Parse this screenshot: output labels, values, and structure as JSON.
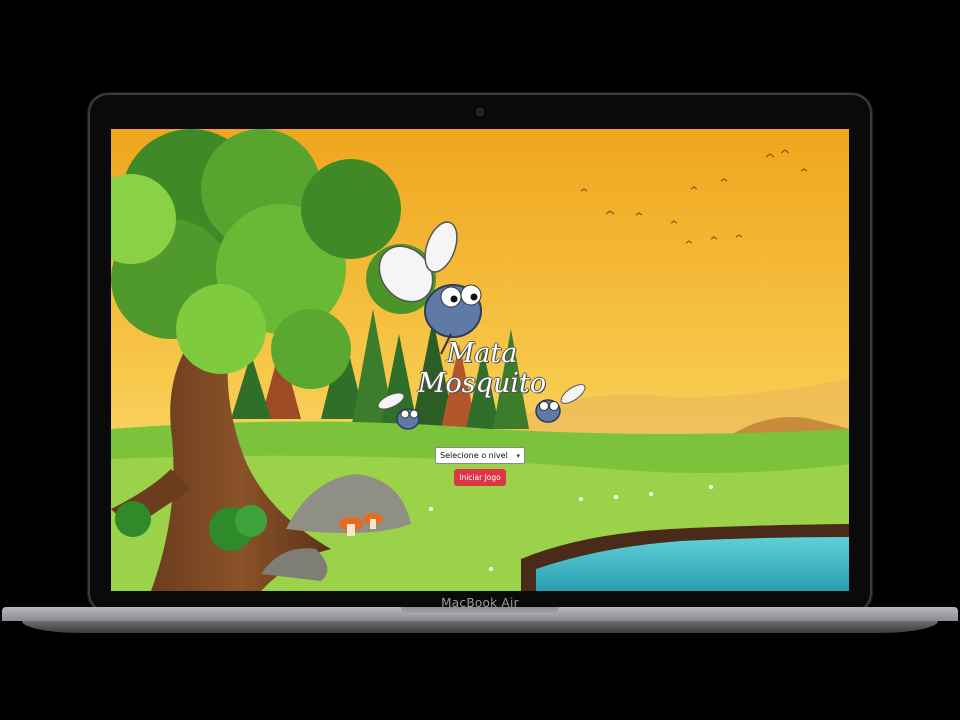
{
  "device": {
    "model_label": "MacBook Air"
  },
  "game": {
    "title_line1": "Mata",
    "title_line2": "Mosquito",
    "level_select": {
      "selected": "Selecione o nivel"
    },
    "start_button": "Iniciar Jogo"
  },
  "colors": {
    "button": "#dc3545",
    "sky_top": "#f2a91e",
    "sky_bottom": "#fbe08a",
    "grass": "#7cc23b",
    "water": "#33b3c0"
  }
}
